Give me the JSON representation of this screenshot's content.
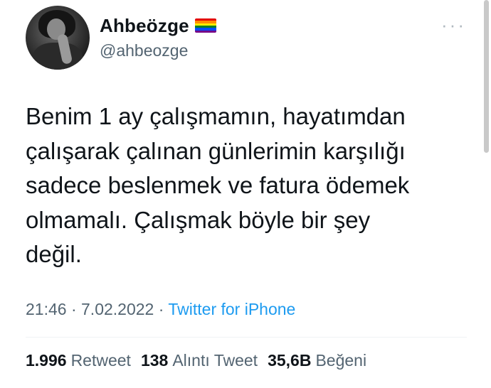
{
  "user": {
    "display_name": "Ahbeözge",
    "handle": "@ahbeozge"
  },
  "icons": {
    "flag": "rainbow-flag-icon",
    "more": "more-dots-icon"
  },
  "tweet": {
    "text": "Benim 1 ay çalışmamın, hayatımdan\nçalışarak çalınan günlerimin karşılığı\nsadece beslenmek ve fatura ödemek\nolmamalı. Çalışmak böyle bir şey\ndeğil.",
    "time": "21:46",
    "separator": " · ",
    "date": "7.02.2022",
    "source": "Twitter for iPhone"
  },
  "stats": {
    "retweets_count": "1.996",
    "retweets_label": "Retweet",
    "quotes_count": "138",
    "quotes_label": "Alıntı Tweet",
    "likes_count": "35,6B",
    "likes_label": "Beğeni"
  },
  "colors": {
    "text": "#0f1419",
    "secondary": "#536471",
    "link": "#1d9bf0",
    "flag": [
      "#e40303",
      "#ff8c00",
      "#ffed00",
      "#008026",
      "#004dff",
      "#750787"
    ]
  }
}
